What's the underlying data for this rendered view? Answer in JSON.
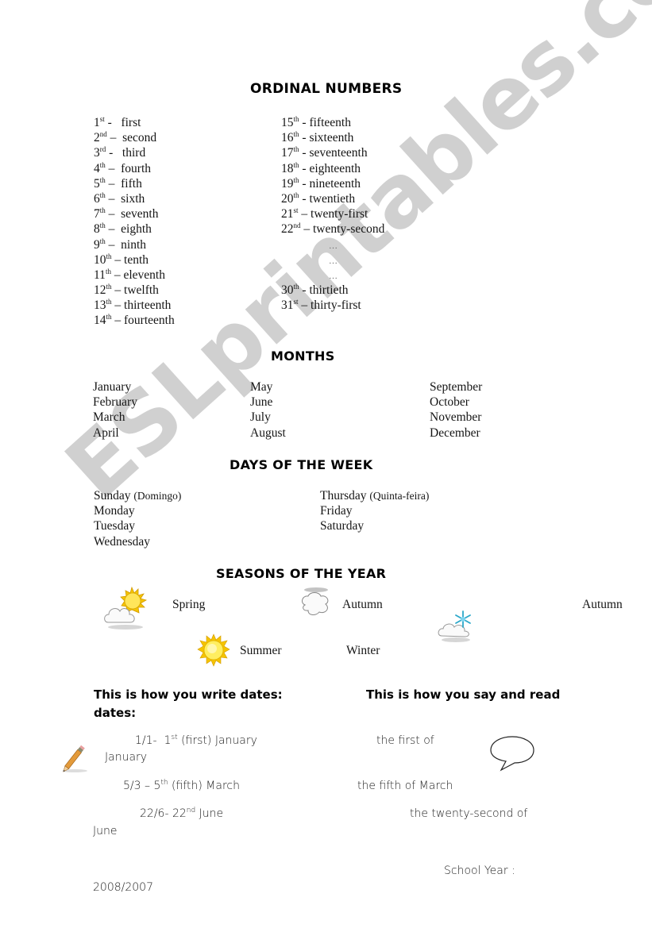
{
  "watermark": "ESLprintables.com",
  "ordinal": {
    "title": "ORDINAL NUMBERS",
    "left": [
      {
        "num": "1",
        "suffix": "st",
        "sep": " -   ",
        "word": "first"
      },
      {
        "num": "2",
        "suffix": "nd",
        "sep": " –  ",
        "word": "second"
      },
      {
        "num": "3",
        "suffix": "rd",
        "sep": " -   ",
        "word": "third"
      },
      {
        "num": "4",
        "suffix": "th",
        "sep": " –  ",
        "word": "fourth"
      },
      {
        "num": "5",
        "suffix": "th",
        "sep": " –  ",
        "word": "fifth"
      },
      {
        "num": "6",
        "suffix": "th",
        "sep": " –  ",
        "word": "sixth"
      },
      {
        "num": "7",
        "suffix": "th",
        "sep": " –  ",
        "word": "seventh"
      },
      {
        "num": "8",
        "suffix": "th",
        "sep": " –  ",
        "word": "eighth"
      },
      {
        "num": "9",
        "suffix": "th",
        "sep": " –  ",
        "word": "ninth"
      },
      {
        "num": "10",
        "suffix": "th",
        "sep": " – ",
        "word": "tenth"
      },
      {
        "num": "11",
        "suffix": "th",
        "sep": " – ",
        "word": "eleventh"
      },
      {
        "num": "12",
        "suffix": "th",
        "sep": " – ",
        "word": "twelfth"
      },
      {
        "num": "13",
        "suffix": "th",
        "sep": " – ",
        "word": "thirteenth"
      },
      {
        "num": "14",
        "suffix": "th",
        "sep": " – ",
        "word": "fourteenth"
      }
    ],
    "right": [
      {
        "num": "15",
        "suffix": "th",
        "sep": " - ",
        "word": "fifteenth"
      },
      {
        "num": "16",
        "suffix": "th",
        "sep": " - ",
        "word": "sixteenth"
      },
      {
        "num": "17",
        "suffix": "th",
        "sep": " - ",
        "word": "seventeenth"
      },
      {
        "num": "18",
        "suffix": "th",
        "sep": " - ",
        "word": "eighteenth"
      },
      {
        "num": "19",
        "suffix": "th",
        "sep": " - ",
        "word": "nineteenth"
      },
      {
        "num": "20",
        "suffix": "th",
        "sep": " - ",
        "word": "twentieth"
      },
      {
        "num": "21",
        "suffix": "st",
        "sep": " – ",
        "word": "twenty-first"
      },
      {
        "num": "22",
        "suffix": "nd",
        "sep": " – ",
        "word": "twenty-second"
      },
      {
        "ellipsis": "…"
      },
      {
        "ellipsis": "…"
      },
      {
        "ellipsis": "…"
      },
      {
        "num": "30",
        "suffix": "th",
        "sep": " - ",
        "word": "thirtieth"
      },
      {
        "num": "31",
        "suffix": "st",
        "sep": " – ",
        "word": "thirty-first"
      }
    ]
  },
  "months": {
    "title": "MONTHS",
    "columns": [
      [
        "January",
        "February",
        "March",
        "April"
      ],
      [
        "May",
        "June",
        "July",
        "August"
      ],
      [
        "September",
        "October",
        "November",
        "December"
      ]
    ]
  },
  "days": {
    "title": "DAYS OF THE WEEK",
    "columns": [
      [
        {
          "name": "Sunday",
          "note": "(Domingo)"
        },
        {
          "name": "Monday"
        },
        {
          "name": "Tuesday"
        },
        {
          "name": "Wednesday"
        }
      ],
      [
        {
          "name": "Thursday",
          "note": "(Quinta-feira)"
        },
        {
          "name": "Friday"
        },
        {
          "name": "Saturday"
        }
      ]
    ]
  },
  "seasons": {
    "title": "SEASONS OF THE YEAR",
    "labels": {
      "spring": "Spring",
      "autumn1": "Autumn",
      "autumn2": "Autumn",
      "summer": "Summer",
      "winter": "Winter"
    },
    "icons": {
      "spring": "sun-behind-cloud-icon",
      "autumn": "cloud-icon",
      "winter": "snow-cloud-icon",
      "summer": "sun-icon"
    }
  },
  "dates": {
    "write_heading_line1": "This is how you write dates:",
    "say_heading": "This is how you say and read",
    "write_heading_line2": "dates:",
    "examples": [
      {
        "numeric": "1/1-",
        "ordinal_num": "1",
        "ordinal_sup": "st",
        "rest": " (first) January",
        "spoken": "the first of",
        "wrap": "January"
      },
      {
        "numeric": "5/3 – ",
        "ordinal_num": "5",
        "ordinal_sup": "th",
        "rest": " (fifth) March",
        "spoken": "the fifth of March"
      },
      {
        "numeric": "22/6- ",
        "ordinal_num": "22",
        "ordinal_sup": "nd",
        "rest": " June",
        "spoken": "the twenty-second of",
        "wrap": "June"
      }
    ],
    "school_year_label": "School Year :",
    "school_year_value": "2008/2007"
  }
}
